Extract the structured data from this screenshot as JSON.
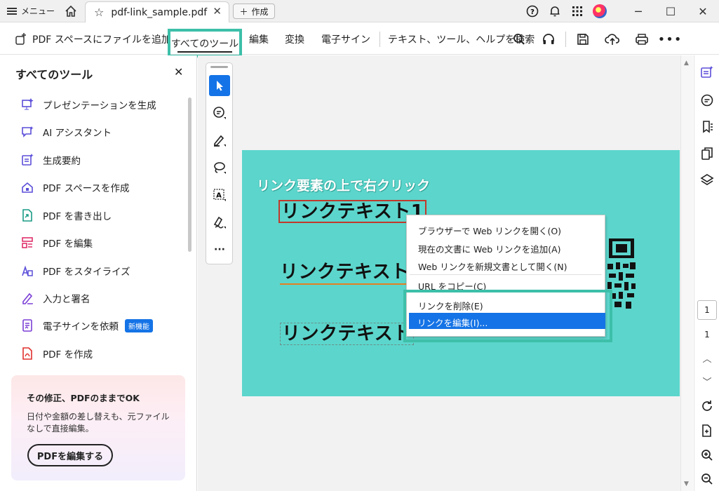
{
  "titlebar": {
    "menu_label": "メニュー",
    "tab_title": "pdf-link_sample.pdf",
    "new_button": "作成",
    "close_glyph": "✕"
  },
  "toolbar": {
    "add_to_space": "PDF スペースにファイルを追加",
    "all_tools": "すべてのツール",
    "edit": "編集",
    "convert": "変換",
    "esign": "電子サイン",
    "search": "テキスト、ツール、ヘルプを検索"
  },
  "left_panel": {
    "title": "すべてのツール",
    "items": [
      {
        "label": "プレゼンテーションを生成",
        "color": "#5b4fd9"
      },
      {
        "label": "AI アシスタント",
        "color": "#5b4fd9"
      },
      {
        "label": "生成要約",
        "color": "#5b4fd9"
      },
      {
        "label": "PDF スペースを作成",
        "color": "#5b4fd9"
      },
      {
        "label": "PDF を書き出し",
        "color": "#1b9c85"
      },
      {
        "label": "PDF を編集",
        "color": "#e0306b"
      },
      {
        "label": "PDF をスタイライズ",
        "color": "#5b4fd9"
      },
      {
        "label": "入力と署名",
        "color": "#7b3fd6"
      },
      {
        "label": "電子サインを依頼",
        "color": "#7b3fd6",
        "badge": "新機能"
      },
      {
        "label": "PDF を作成",
        "color": "#e0302d"
      }
    ],
    "promo": {
      "heading": "その修正、PDFのままでOK",
      "body": "日付や金額の差し替えも、元ファイルなしで直接編集。",
      "button": "PDFを編集する"
    }
  },
  "document": {
    "caption": "リンク要素の上で右クリック",
    "links": [
      "リンクテキスト1",
      "リンクテキスト",
      "リンクテキスト"
    ],
    "page_color": "#5cd6cc"
  },
  "context_menu": {
    "items": [
      "ブラウザーで Web リンクを開く(O)",
      "現在の文書に Web リンクを追加(A)",
      "Web リンクを新規文書として開く(N)",
      "URL をコピー(C)",
      "リンクを削除(E)",
      "リンクを編集(I)..."
    ],
    "selected_index": 5,
    "highlight_color": "#1473e6"
  },
  "right_rail": {
    "current_page": "1",
    "page_count": "1"
  },
  "colors": {
    "accent_teal": "#3dbfa9",
    "adobe_blue": "#1473e6"
  }
}
